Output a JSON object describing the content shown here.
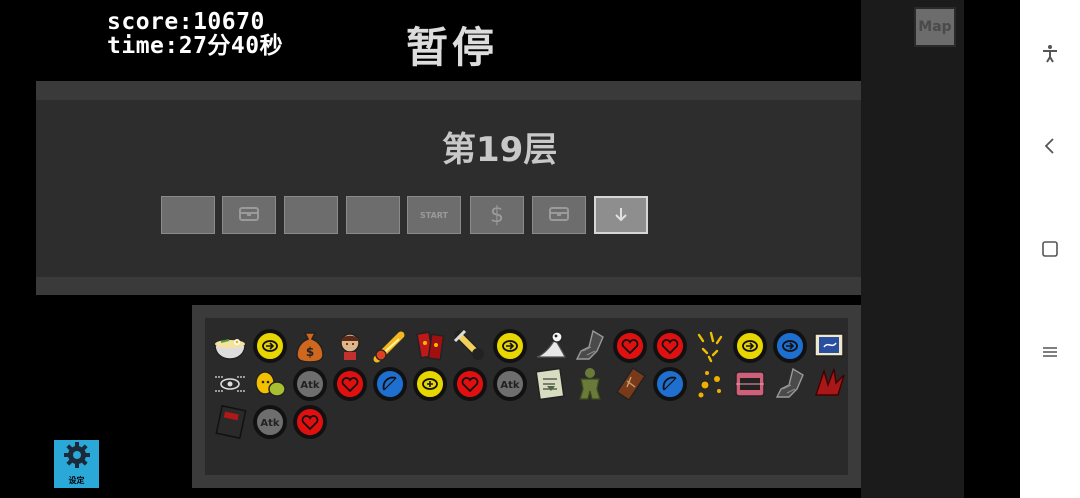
{
  "hud": {
    "score": "score:10670",
    "time": "time:27分40秒"
  },
  "pause_title": "暂停",
  "map_label": "Map",
  "floor": {
    "title": "第19层",
    "rooms": [
      {
        "type": "empty",
        "label": ""
      },
      {
        "type": "chest",
        "label": ""
      },
      {
        "type": "empty",
        "label": ""
      },
      {
        "type": "empty",
        "label": ""
      },
      {
        "type": "start",
        "label": "START"
      },
      {
        "type": "shop",
        "label": "$"
      },
      {
        "type": "chest",
        "label": ""
      },
      {
        "type": "exit-current",
        "label": ""
      }
    ]
  },
  "inventory": {
    "items": [
      {
        "icon": "noodle-bowl-icon"
      },
      {
        "icon": "yellow-speed-coin-icon"
      },
      {
        "icon": "money-bag-icon"
      },
      {
        "icon": "girl-portrait-icon"
      },
      {
        "icon": "comet-icon"
      },
      {
        "icon": "red-cards-icon"
      },
      {
        "icon": "syringe-icon"
      },
      {
        "icon": "yellow-speed-coin-icon"
      },
      {
        "icon": "bird-skull-icon"
      },
      {
        "icon": "armored-boot-icon"
      },
      {
        "icon": "red-heart-coin-icon"
      },
      {
        "icon": "red-heart-coin-icon"
      },
      {
        "icon": "sparks-icon"
      },
      {
        "icon": "yellow-speed-coin-icon"
      },
      {
        "icon": "blue-speed-coin-icon"
      },
      {
        "icon": "blue-card-icon"
      },
      {
        "icon": "eye-sigil-icon"
      },
      {
        "icon": "lemon-duo-icon"
      },
      {
        "icon": "gray-attack-coin-icon"
      },
      {
        "icon": "red-heart-coin-icon"
      },
      {
        "icon": "blue-bow-coin-icon"
      },
      {
        "icon": "yellow-plus-coin-icon"
      },
      {
        "icon": "red-heart-coin-icon"
      },
      {
        "icon": "gray-attack-coin-icon"
      },
      {
        "icon": "book-page-icon"
      },
      {
        "icon": "ghillie-suit-icon"
      },
      {
        "icon": "coffin-icon"
      },
      {
        "icon": "blue-bow-coin-icon"
      },
      {
        "icon": "gold-orbs-icon"
      },
      {
        "icon": "pink-chest-icon"
      },
      {
        "icon": "armored-boot-icon"
      },
      {
        "icon": "red-claw-icon"
      },
      {
        "icon": "red-book-icon"
      },
      {
        "icon": "gray-attack-coin-icon"
      },
      {
        "icon": "red-heart-coin-icon"
      }
    ],
    "coin_labels": {
      "atk": "Atk"
    }
  },
  "settings": {
    "label": "设定"
  },
  "colors": {
    "yellow_coin": "#e8d600",
    "blue_coin": "#1f6fd1",
    "red_coin": "#e01010",
    "gray_coin": "#6e6e6e",
    "settings_bg": "#2aa8d8"
  }
}
